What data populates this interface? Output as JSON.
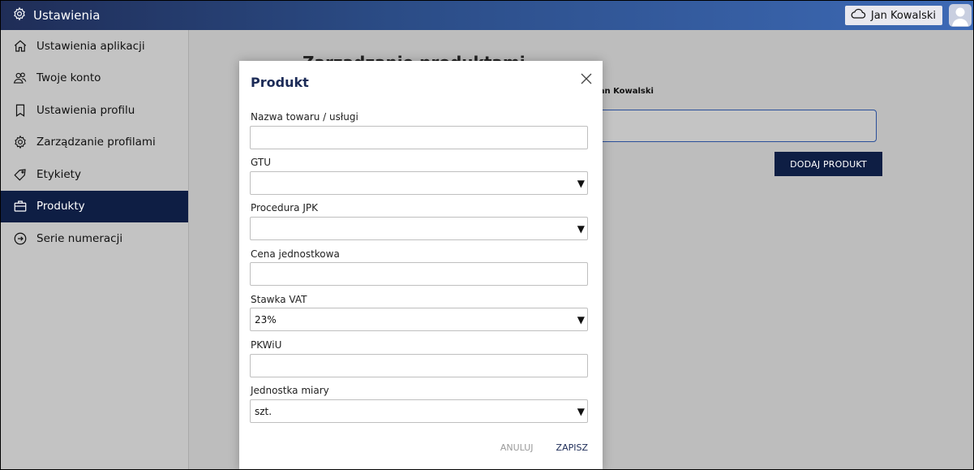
{
  "topbar": {
    "title": "Ustawienia",
    "user_name": "Jan Kowalski",
    "brand_gradient": [
      "#1f2d57",
      "#3d6ab6"
    ]
  },
  "sidebar": {
    "items": [
      {
        "label": "Ustawienia aplikacji",
        "icon": "home-icon",
        "active": false
      },
      {
        "label": "Twoje konto",
        "icon": "users-icon",
        "active": false
      },
      {
        "label": "Ustawienia profilu",
        "icon": "bookmark-icon",
        "active": false
      },
      {
        "label": "Zarządzanie profilami",
        "icon": "gear-icon",
        "active": false
      },
      {
        "label": "Etykiety",
        "icon": "tag-icon",
        "active": false
      },
      {
        "label": "Produkty",
        "icon": "briefcase-icon",
        "active": true
      },
      {
        "label": "Serie numeracji",
        "icon": "arrow-circle-icon",
        "active": false
      }
    ]
  },
  "main": {
    "heading": "Zarządzanie produktami",
    "user_label": "Jan Kowalski",
    "add_button": "DODAJ PRODUKT"
  },
  "modal": {
    "title": "Produkt",
    "fields": {
      "name_label": "Nazwa towaru / usługi",
      "name_value": "",
      "gtu_label": "GTU",
      "gtu_value": "",
      "jpk_label": "Procedura JPK",
      "jpk_value": "",
      "price_label": "Cena jednostkowa",
      "price_value": "",
      "vat_label": "Stawka VAT",
      "vat_value": "23%",
      "pkwiu_label": "PKWiU",
      "pkwiu_value": "",
      "unit_label": "Jednostka miary",
      "unit_value": "szt."
    },
    "cancel_label": "ANULUJ",
    "save_label": "ZAPISZ"
  },
  "colors": {
    "accent_dark": "#0e1e44",
    "modal_title": "#1c2b57",
    "overlay": "#bdbdbd"
  }
}
